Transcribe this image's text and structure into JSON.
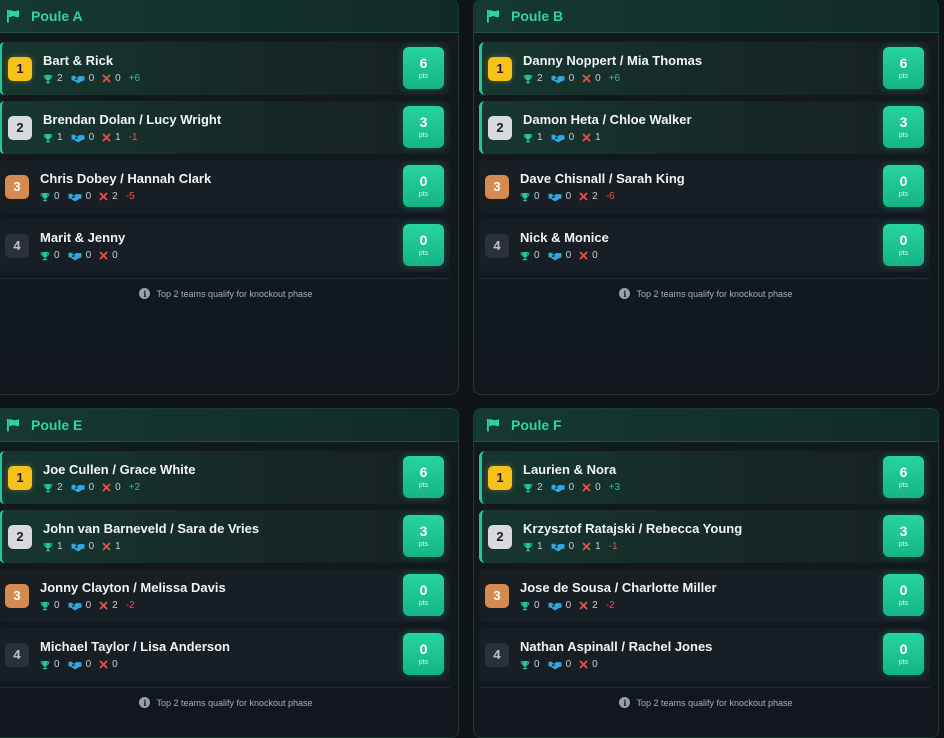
{
  "pts_label": "pts",
  "footnote": "Top 2 teams qualify for knockout phase",
  "info_glyph": "i",
  "colors": {
    "accent": "#2ed3a3",
    "trophy": "#22c796",
    "draw": "#2fa8e0",
    "loss": "#ef4f4f"
  },
  "groups": [
    {
      "title": "Poule A",
      "teams": [
        {
          "rank": "1",
          "name": "Bart & Rick",
          "wins": "2",
          "draws": "0",
          "losses": "0",
          "diff": "+6",
          "pts": "6"
        },
        {
          "rank": "2",
          "name": "Brendan Dolan / Lucy Wright",
          "wins": "1",
          "draws": "0",
          "losses": "1",
          "diff": "-1",
          "pts": "3"
        },
        {
          "rank": "3",
          "name": "Chris Dobey / Hannah Clark",
          "wins": "0",
          "draws": "0",
          "losses": "2",
          "diff": "-5",
          "pts": "0"
        },
        {
          "rank": "4",
          "name": "Marit & Jenny",
          "wins": "0",
          "draws": "0",
          "losses": "0",
          "diff": "",
          "pts": "0"
        }
      ]
    },
    {
      "title": "Poule B",
      "teams": [
        {
          "rank": "1",
          "name": "Danny Noppert / Mia Thomas",
          "wins": "2",
          "draws": "0",
          "losses": "0",
          "diff": "+6",
          "pts": "6"
        },
        {
          "rank": "2",
          "name": "Damon Heta / Chloe Walker",
          "wins": "1",
          "draws": "0",
          "losses": "1",
          "diff": "",
          "pts": "3"
        },
        {
          "rank": "3",
          "name": "Dave Chisnall / Sarah King",
          "wins": "0",
          "draws": "0",
          "losses": "2",
          "diff": "-6",
          "pts": "0"
        },
        {
          "rank": "4",
          "name": "Nick & Monice",
          "wins": "0",
          "draws": "0",
          "losses": "0",
          "diff": "",
          "pts": "0"
        }
      ]
    },
    {
      "title": "Poule E",
      "teams": [
        {
          "rank": "1",
          "name": "Joe Cullen / Grace White",
          "wins": "2",
          "draws": "0",
          "losses": "0",
          "diff": "+2",
          "pts": "6"
        },
        {
          "rank": "2",
          "name": "John van Barneveld / Sara de Vries",
          "wins": "1",
          "draws": "0",
          "losses": "1",
          "diff": "",
          "pts": "3"
        },
        {
          "rank": "3",
          "name": "Jonny Clayton / Melissa Davis",
          "wins": "0",
          "draws": "0",
          "losses": "2",
          "diff": "-2",
          "pts": "0"
        },
        {
          "rank": "4",
          "name": "Michael Taylor / Lisa Anderson",
          "wins": "0",
          "draws": "0",
          "losses": "0",
          "diff": "",
          "pts": "0"
        }
      ]
    },
    {
      "title": "Poule F",
      "teams": [
        {
          "rank": "1",
          "name": "Laurien & Nora",
          "wins": "2",
          "draws": "0",
          "losses": "0",
          "diff": "+3",
          "pts": "6"
        },
        {
          "rank": "2",
          "name": "Krzysztof Ratajski / Rebecca Young",
          "wins": "1",
          "draws": "0",
          "losses": "1",
          "diff": "-1",
          "pts": "3"
        },
        {
          "rank": "3",
          "name": "Jose de Sousa / Charlotte Miller",
          "wins": "0",
          "draws": "0",
          "losses": "2",
          "diff": "-2",
          "pts": "0"
        },
        {
          "rank": "4",
          "name": "Nathan Aspinall / Rachel Jones",
          "wins": "0",
          "draws": "0",
          "losses": "0",
          "diff": "",
          "pts": "0"
        }
      ]
    }
  ]
}
